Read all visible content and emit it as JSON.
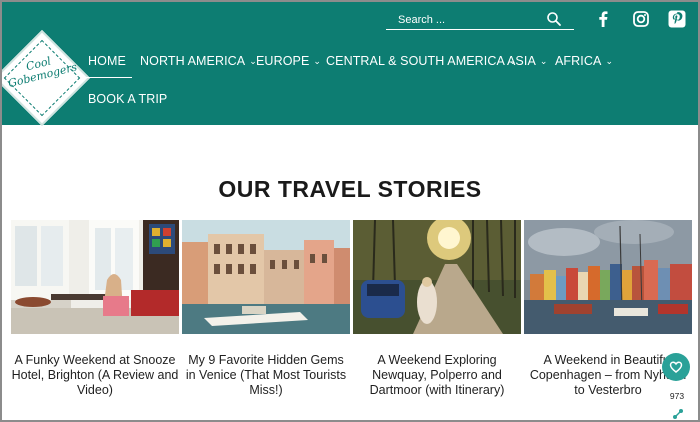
{
  "brand": {
    "logo_text": "Cool Gobemogers"
  },
  "search": {
    "placeholder": "Search ..."
  },
  "social": {
    "facebook": "facebook-icon",
    "instagram": "instagram-icon",
    "pinterest": "pinterest-icon"
  },
  "nav": {
    "home": "HOME",
    "north_america": "NORTH AMERICA",
    "europe": "EUROPE",
    "central_south_america": "CENTRAL & SOUTH AMERICA",
    "asia": "ASIA",
    "africa": "AFRICA",
    "book_a_trip": "BOOK A TRIP"
  },
  "section": {
    "title": "OUR TRAVEL STORIES"
  },
  "stories": [
    {
      "title": "A Funky Weekend at Snooze Hotel, Brighton (A Review and Video)"
    },
    {
      "title": "My 9 Favorite Hidden Gems in Venice (That Most Tourists Miss!)"
    },
    {
      "title": "A Weekend Exploring Newquay, Polperro and Dartmoor (with Itinerary)"
    },
    {
      "title": "A Weekend in Beautiful Copenhagen – from Nyhavn to Vesterbro"
    }
  ],
  "floating": {
    "favorite_count": "973"
  },
  "colors": {
    "header_bg": "#0d7d72",
    "accent": "#2aa198"
  }
}
